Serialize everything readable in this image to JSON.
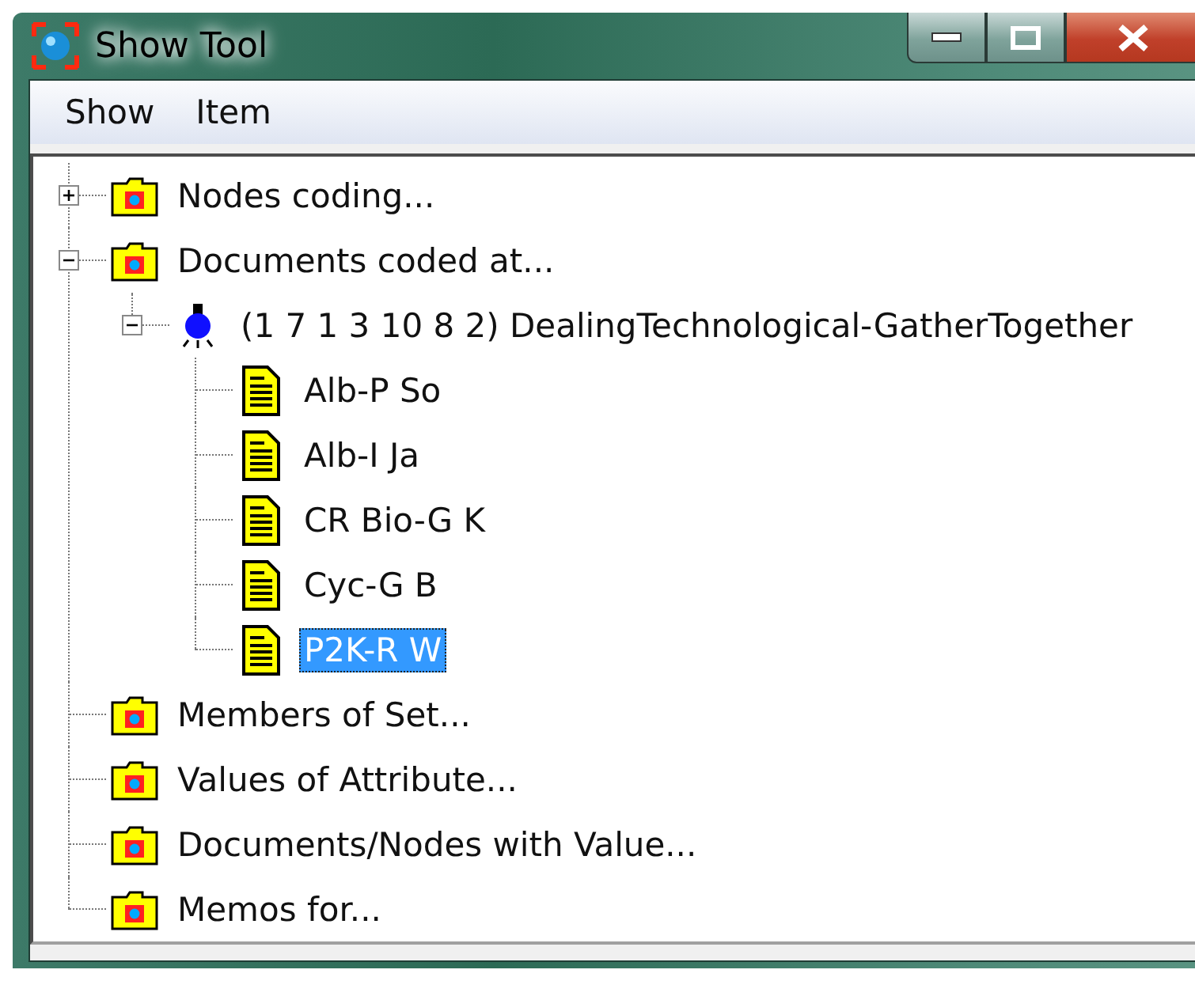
{
  "window": {
    "title": "Show Tool"
  },
  "menu": [
    {
      "label": "Show"
    },
    {
      "label": "Item"
    }
  ],
  "tree": {
    "items": [
      {
        "kind": "folder",
        "label": "Nodes coding...",
        "expanded": false,
        "selected": false
      },
      {
        "kind": "folder",
        "label": "Documents coded at...",
        "expanded": true,
        "selected": false,
        "children": [
          {
            "kind": "node",
            "label": "(1 7 1 3 10 8 2) DealingTechnological-GatherTogether",
            "expanded": true,
            "selected": false,
            "children": [
              {
                "kind": "document",
                "label": "Alb-P So",
                "selected": false
              },
              {
                "kind": "document",
                "label": "Alb-I Ja",
                "selected": false
              },
              {
                "kind": "document",
                "label": "CR Bio-G K",
                "selected": false
              },
              {
                "kind": "document",
                "label": "Cyc-G B",
                "selected": false
              },
              {
                "kind": "document",
                "label": "P2K-R W",
                "selected": true
              }
            ]
          }
        ]
      },
      {
        "kind": "folder",
        "label": "Members of Set...",
        "selected": false
      },
      {
        "kind": "folder",
        "label": "Values of Attribute...",
        "selected": false
      },
      {
        "kind": "folder",
        "label": "Documents/Nodes with Value...",
        "selected": false
      },
      {
        "kind": "folder",
        "label": "Memos for...",
        "selected": false
      }
    ]
  }
}
